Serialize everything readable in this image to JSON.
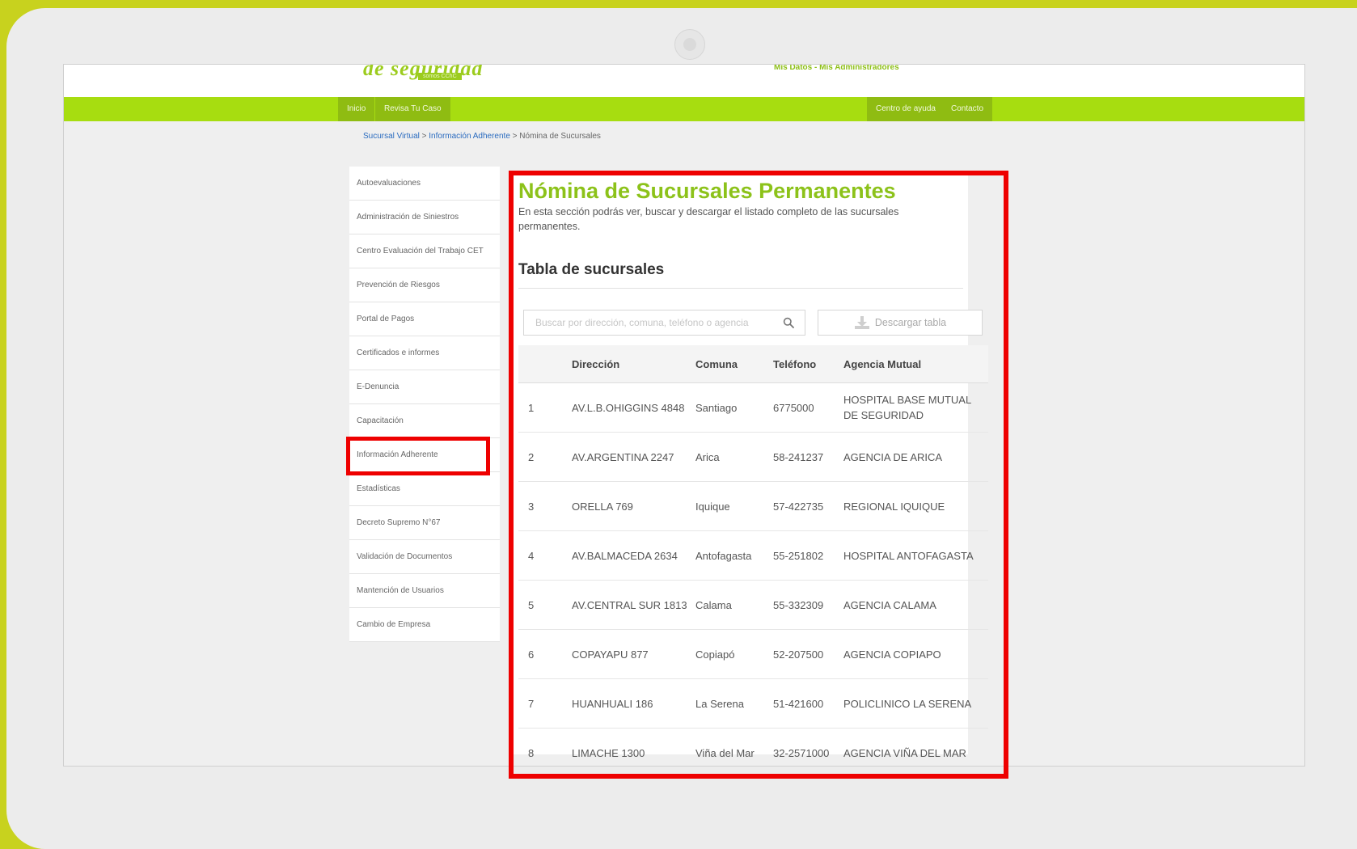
{
  "header": {
    "logo_text": "de seguridad",
    "logo_sub": "somos CChC",
    "links": "Mis Datos - Mis Administradores"
  },
  "nav": {
    "left": [
      "Inicio",
      "Revisa Tu Caso"
    ],
    "right": [
      "Centro de ayuda",
      "Contacto"
    ]
  },
  "breadcrumb": {
    "root": "Sucursal Virtual",
    "sep": " > ",
    "parent": "Información Adherente",
    "current": "Nómina de Sucursales"
  },
  "sidebar": {
    "items": [
      "Autoevaluaciones",
      "Administración de Siniestros",
      "Centro Evaluación del Trabajo CET",
      "Prevención de Riesgos",
      "Portal de Pagos",
      "Certificados e informes",
      "E-Denuncia",
      "Capacitación",
      "Información Adherente",
      "Estadísticas",
      "Decreto Supremo N°67",
      "Validación de Documentos",
      "Mantención de Usuarios",
      "Cambio de Empresa"
    ]
  },
  "main": {
    "title": "Nómina de Sucursales Permanentes",
    "description": "En esta sección podrás ver, buscar y descargar el listado completo de las sucursales permanentes.",
    "table_title": "Tabla de sucursales",
    "search_placeholder": "Buscar por dirección, comuna, teléfono o agencia",
    "download_label": "Descargar tabla",
    "columns": [
      "",
      "Dirección",
      "Comuna",
      "Teléfono",
      "Agencia Mutual"
    ],
    "rows": [
      [
        "1",
        "AV.L.B.OHIGGINS 4848",
        "Santiago",
        "6775000",
        "HOSPITAL BASE MUTUAL DE SEGURIDAD"
      ],
      [
        "2",
        "AV.ARGENTINA 2247",
        "Arica",
        "58-241237",
        "AGENCIA DE ARICA"
      ],
      [
        "3",
        "ORELLA 769",
        "Iquique",
        "57-422735",
        "REGIONAL IQUIQUE"
      ],
      [
        "4",
        "AV.BALMACEDA 2634",
        "Antofagasta",
        "55-251802",
        "HOSPITAL ANTOFAGASTA"
      ],
      [
        "5",
        "AV.CENTRAL SUR 1813",
        "Calama",
        "55-332309",
        "AGENCIA CALAMA"
      ],
      [
        "6",
        "COPAYAPU 877",
        "Copiapó",
        "52-207500",
        "AGENCIA COPIAPO"
      ],
      [
        "7",
        "HUANHUALI 186",
        "La Serena",
        "51-421600",
        "POLICLINICO LA SERENA"
      ],
      [
        "8",
        "LIMACHE 1300",
        "Viña del Mar",
        "32-2571000",
        "AGENCIA VIÑA DEL MAR"
      ]
    ]
  },
  "colors": {
    "accent": "#8cc21a",
    "nav_bar": "#a7dd10",
    "highlight": "#ee0000"
  }
}
